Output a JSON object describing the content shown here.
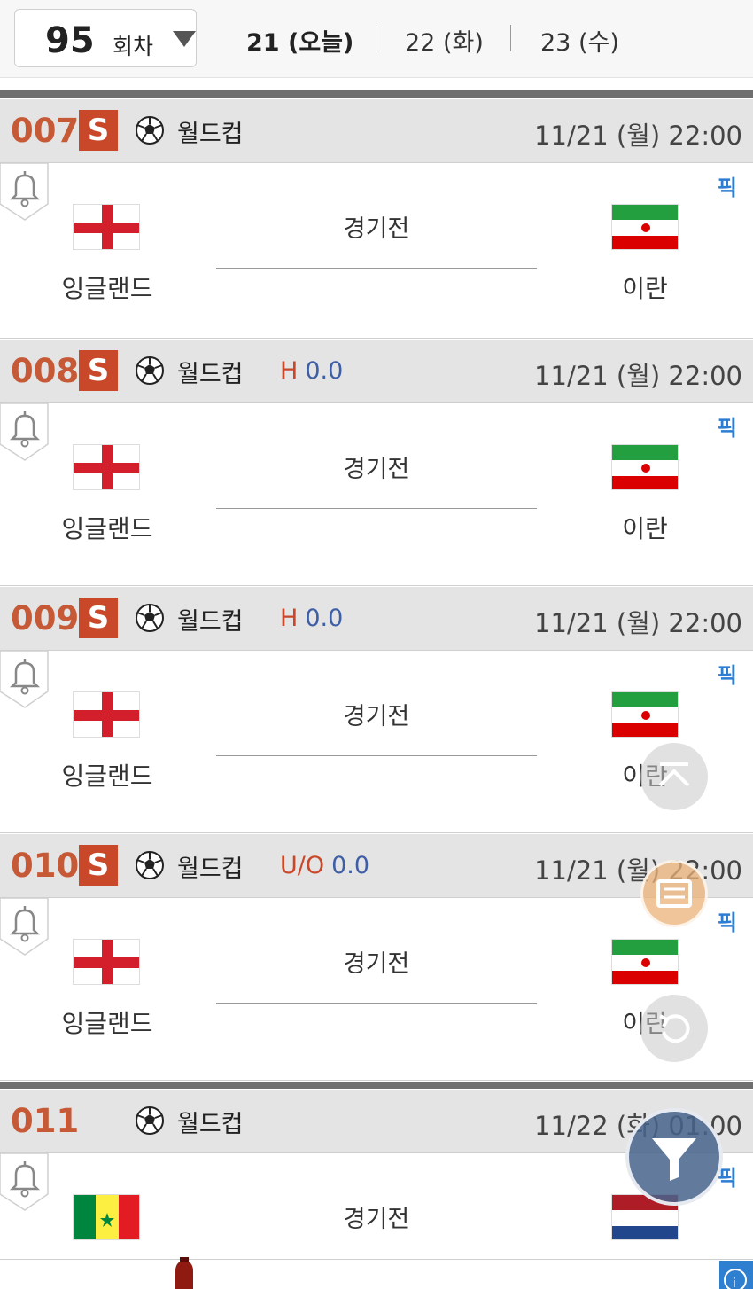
{
  "round": {
    "number": "95",
    "unit": "회차"
  },
  "day_tabs": [
    {
      "label": "21 (오늘)",
      "active": true
    },
    {
      "label": "22 (화)",
      "active": false
    },
    {
      "label": "23 (수)",
      "active": false
    }
  ],
  "games": [
    {
      "no": "007",
      "badge": "S",
      "league": "월드컵",
      "handicap_type": "",
      "handicap_value": "",
      "time": "11/21 (월)  22:00",
      "pick": "픽",
      "status": "경기전",
      "home": {
        "name": "잉글랜드",
        "flag": "england"
      },
      "away": {
        "name": "이란",
        "flag": "iran"
      }
    },
    {
      "no": "008",
      "badge": "S",
      "league": "월드컵",
      "handicap_type": "H",
      "handicap_value": "0.0",
      "time": "11/21 (월)  22:00",
      "pick": "픽",
      "status": "경기전",
      "home": {
        "name": "잉글랜드",
        "flag": "england"
      },
      "away": {
        "name": "이란",
        "flag": "iran"
      }
    },
    {
      "no": "009",
      "badge": "S",
      "league": "월드컵",
      "handicap_type": "H",
      "handicap_value": "0.0",
      "time": "11/21 (월)  22:00",
      "pick": "픽",
      "status": "경기전",
      "home": {
        "name": "잉글랜드",
        "flag": "england"
      },
      "away": {
        "name": "이란",
        "flag": "iran"
      }
    },
    {
      "no": "010",
      "badge": "S",
      "league": "월드컵",
      "handicap_type": "U/O",
      "handicap_value": "0.0",
      "time": "11/21 (월)  22:00",
      "pick": "픽",
      "status": "경기전",
      "home": {
        "name": "잉글랜드",
        "flag": "england"
      },
      "away": {
        "name": "이란",
        "flag": "iran"
      }
    },
    {
      "no": "011",
      "badge": "",
      "league": "월드컵",
      "handicap_type": "",
      "handicap_value": "",
      "time": "11/22 (화)  01:00",
      "pick": "픽",
      "status": "경기전",
      "home": {
        "name": "",
        "flag": "senegal"
      },
      "away": {
        "name": "",
        "flag": "netherlands"
      }
    }
  ],
  "icons": {
    "ball": "soccer-ball-icon",
    "bell": "bell-icon",
    "up": "scroll-top-icon",
    "list": "list-icon",
    "refresh": "refresh-icon",
    "filter": "filter-icon",
    "info": "info-icon"
  },
  "colors": {
    "game_number": "#c65a37",
    "badge": "#c9482a",
    "handicap_type": "#c9482a",
    "handicap_value": "#3e5ea5",
    "pick": "#2d7dd2"
  }
}
